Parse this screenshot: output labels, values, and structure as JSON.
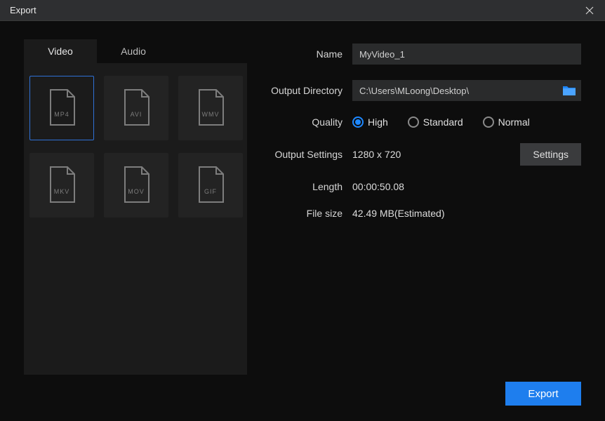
{
  "window": {
    "title": "Export"
  },
  "tabs": {
    "video": "Video",
    "audio": "Audio",
    "active": "video"
  },
  "formats": [
    {
      "label": "MP4",
      "selected": true
    },
    {
      "label": "AVI",
      "selected": false
    },
    {
      "label": "WMV",
      "selected": false
    },
    {
      "label": "MKV",
      "selected": false
    },
    {
      "label": "MOV",
      "selected": false
    },
    {
      "label": "GIF",
      "selected": false
    }
  ],
  "labels": {
    "name": "Name",
    "output_dir": "Output Directory",
    "quality": "Quality",
    "output_settings": "Output Settings",
    "length": "Length",
    "file_size": "File size"
  },
  "values": {
    "name": "MyVideo_1",
    "output_dir": "C:\\Users\\MLoong\\Desktop\\",
    "output_settings": "1280 x 720",
    "length": "00:00:50.08",
    "file_size": "42.49 MB(Estimated)"
  },
  "quality": {
    "options": {
      "high": "High",
      "standard": "Standard",
      "normal": "Normal"
    },
    "selected": "high"
  },
  "buttons": {
    "settings": "Settings",
    "export": "Export"
  }
}
